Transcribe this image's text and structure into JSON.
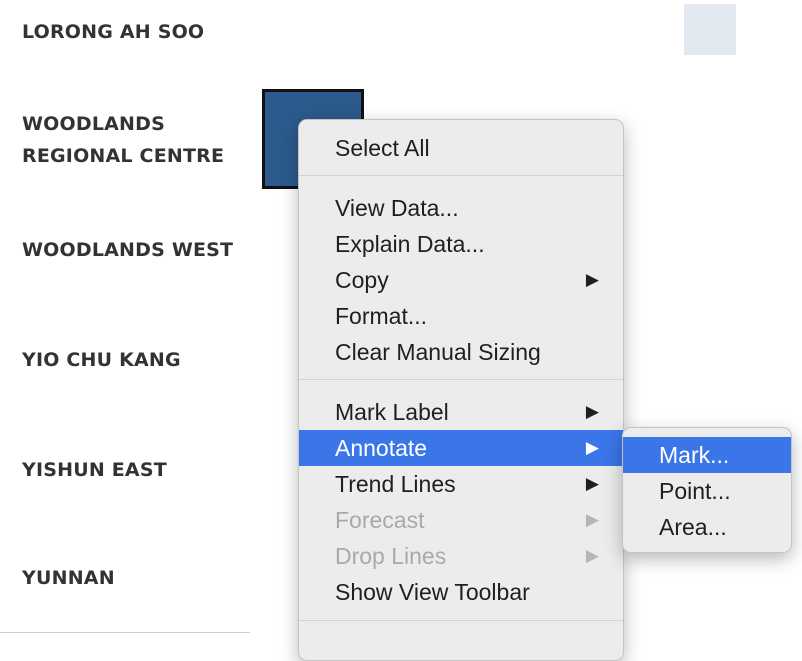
{
  "rows": [
    {
      "label": "LORONG AH SOO"
    },
    {
      "label_line1": "WOODLANDS",
      "label_line2": "REGIONAL CENTRE"
    },
    {
      "label": "WOODLANDS WEST"
    },
    {
      "label": "YIO CHU KANG"
    },
    {
      "label": "YISHUN EAST"
    },
    {
      "label": "YUNNAN"
    }
  ],
  "colors": {
    "light_cell": "#e3e9f1",
    "selected_cell": "#2c5a8c",
    "menu_highlight": "#3a76e8"
  },
  "context_menu": {
    "items": [
      {
        "label": "Select All",
        "submenu": false,
        "enabled": true
      },
      {
        "label": "View Data...",
        "submenu": false,
        "enabled": true
      },
      {
        "label": "Explain Data...",
        "submenu": false,
        "enabled": true
      },
      {
        "label": "Copy",
        "submenu": true,
        "enabled": true
      },
      {
        "label": "Format...",
        "submenu": false,
        "enabled": true
      },
      {
        "label": "Clear Manual Sizing",
        "submenu": false,
        "enabled": true
      },
      {
        "label": "Mark Label",
        "submenu": true,
        "enabled": true
      },
      {
        "label": "Annotate",
        "submenu": true,
        "enabled": true,
        "highlighted": true
      },
      {
        "label": "Trend Lines",
        "submenu": true,
        "enabled": true
      },
      {
        "label": "Forecast",
        "submenu": true,
        "enabled": false
      },
      {
        "label": "Drop Lines",
        "submenu": true,
        "enabled": false
      },
      {
        "label": "Show View Toolbar",
        "submenu": false,
        "enabled": true
      }
    ],
    "arrow_glyph": "▶"
  },
  "submenu": {
    "items": [
      {
        "label": "Mark...",
        "highlighted": true
      },
      {
        "label": "Point..."
      },
      {
        "label": "Area..."
      }
    ]
  }
}
